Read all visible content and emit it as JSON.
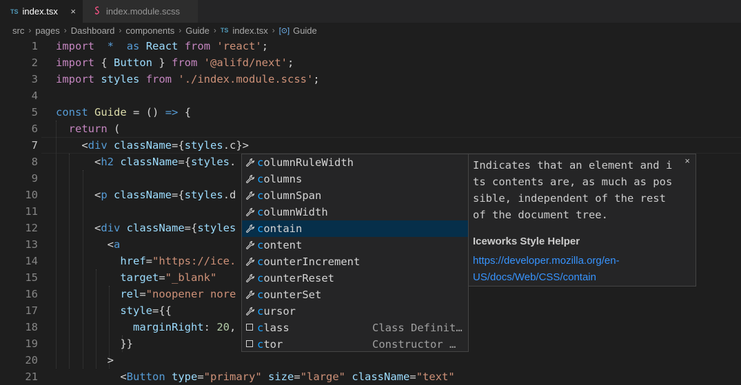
{
  "tabs": [
    {
      "badge": "TS",
      "label": "index.tsx",
      "close": "×",
      "active": true
    },
    {
      "badge": "",
      "label": "index.module.scss",
      "active": false
    }
  ],
  "breadcrumb": {
    "items": [
      "src",
      "pages",
      "Dashboard",
      "components",
      "Guide"
    ],
    "file_badge": "TS",
    "file": "index.tsx",
    "symbol_icon": "[⊙]",
    "symbol": "Guide",
    "separator": "›"
  },
  "editor": {
    "line_numbers": [
      "1",
      "2",
      "3",
      "4",
      "5",
      "6",
      "7",
      "8",
      "9",
      "10",
      "11",
      "12",
      "13",
      "14",
      "15",
      "16",
      "17",
      "18",
      "19",
      "20",
      "21"
    ],
    "current_line": "7",
    "lines": [
      [
        [
          "kc",
          "import"
        ],
        [
          "",
          "  "
        ],
        [
          "kw",
          "*"
        ],
        [
          "",
          "  "
        ],
        [
          "kw",
          "as"
        ],
        [
          "",
          " "
        ],
        [
          "var",
          "React"
        ],
        [
          "",
          " "
        ],
        [
          "kc",
          "from"
        ],
        [
          "",
          " "
        ],
        [
          "str",
          "'react'"
        ],
        [
          "",
          ";"
        ]
      ],
      [
        [
          "kc",
          "import"
        ],
        [
          "",
          " { "
        ],
        [
          "var",
          "Button"
        ],
        [
          "",
          " } "
        ],
        [
          "kc",
          "from"
        ],
        [
          "",
          " "
        ],
        [
          "str",
          "'@alifd/next'"
        ],
        [
          "",
          ";"
        ]
      ],
      [
        [
          "kc",
          "import"
        ],
        [
          "",
          " "
        ],
        [
          "var",
          "styles"
        ],
        [
          "",
          " "
        ],
        [
          "kc",
          "from"
        ],
        [
          "",
          " "
        ],
        [
          "str",
          "'./index.module.scss'"
        ],
        [
          "",
          ";"
        ]
      ],
      [],
      [
        [
          "kw",
          "const"
        ],
        [
          "",
          " "
        ],
        [
          "fn",
          "Guide"
        ],
        [
          "",
          " = () "
        ],
        [
          "kw",
          "=>"
        ],
        [
          "",
          " {"
        ]
      ],
      [
        [
          "",
          ""
        ],
        [
          "kc",
          "  return"
        ],
        [
          "",
          " ("
        ]
      ],
      [
        [
          "",
          "    <"
        ],
        [
          "tag",
          "div"
        ],
        [
          "",
          " "
        ],
        [
          "attr",
          "className"
        ],
        [
          "",
          "={"
        ],
        [
          "var",
          "styles"
        ],
        [
          "",
          ".c}>"
        ]
      ],
      [
        [
          "",
          "      <"
        ],
        [
          "tag",
          "h2"
        ],
        [
          "",
          " "
        ],
        [
          "attr",
          "className"
        ],
        [
          "",
          "={"
        ],
        [
          "var",
          "styles"
        ],
        [
          "",
          "."
        ]
      ],
      [],
      [
        [
          "",
          "      <"
        ],
        [
          "tag",
          "p"
        ],
        [
          "",
          " "
        ],
        [
          "attr",
          "className"
        ],
        [
          "",
          "={"
        ],
        [
          "var",
          "styles"
        ],
        [
          "",
          ".d"
        ]
      ],
      [],
      [
        [
          "",
          "      <"
        ],
        [
          "tag",
          "div"
        ],
        [
          "",
          " "
        ],
        [
          "attr",
          "className"
        ],
        [
          "",
          "={"
        ],
        [
          "var",
          "styles"
        ]
      ],
      [
        [
          "",
          "        <"
        ],
        [
          "tag",
          "a"
        ]
      ],
      [
        [
          "attr",
          "          href"
        ],
        [
          "",
          "="
        ],
        [
          "str",
          "\"https://ice."
        ]
      ],
      [
        [
          "attr",
          "          target"
        ],
        [
          "",
          "="
        ],
        [
          "str",
          "\"_blank\""
        ]
      ],
      [
        [
          "attr",
          "          rel"
        ],
        [
          "",
          "="
        ],
        [
          "str",
          "\"noopener nore"
        ]
      ],
      [
        [
          "attr",
          "          style"
        ],
        [
          "",
          "={{"
        ]
      ],
      [
        [
          "var",
          "            marginRight"
        ],
        [
          "",
          ": "
        ],
        [
          "num",
          "20"
        ],
        [
          "",
          ","
        ]
      ],
      [
        [
          "",
          "          }}"
        ]
      ],
      [
        [
          "",
          "        >"
        ]
      ],
      [
        [
          "",
          "          <"
        ],
        [
          "tag",
          "Button"
        ],
        [
          "",
          " "
        ],
        [
          "attr",
          "type"
        ],
        [
          "",
          "="
        ],
        [
          "str",
          "\"primary\""
        ],
        [
          "",
          " "
        ],
        [
          "attr",
          "size"
        ],
        [
          "",
          "="
        ],
        [
          "str",
          "\"large\""
        ],
        [
          "",
          " "
        ],
        [
          "attr",
          "className"
        ],
        [
          "",
          "="
        ],
        [
          "str",
          "\"text\""
        ]
      ]
    ]
  },
  "suggest": {
    "items": [
      {
        "icon": "wrench-icon",
        "match": "c",
        "rest": "olumnRuleWidth",
        "detail": ""
      },
      {
        "icon": "wrench-icon",
        "match": "c",
        "rest": "olumns",
        "detail": ""
      },
      {
        "icon": "wrench-icon",
        "match": "c",
        "rest": "olumnSpan",
        "detail": ""
      },
      {
        "icon": "wrench-icon",
        "match": "c",
        "rest": "olumnWidth",
        "detail": ""
      },
      {
        "icon": "wrench-icon",
        "match": "c",
        "rest": "ontain",
        "detail": "",
        "selected": true
      },
      {
        "icon": "wrench-icon",
        "match": "c",
        "rest": "ontent",
        "detail": ""
      },
      {
        "icon": "wrench-icon",
        "match": "c",
        "rest": "ounterIncrement",
        "detail": ""
      },
      {
        "icon": "wrench-icon",
        "match": "c",
        "rest": "ounterReset",
        "detail": ""
      },
      {
        "icon": "wrench-icon",
        "match": "c",
        "rest": "ounterSet",
        "detail": ""
      },
      {
        "icon": "wrench-icon",
        "match": "c",
        "rest": "ursor",
        "detail": ""
      },
      {
        "icon": "snippet-icon",
        "match": "c",
        "rest": "lass",
        "detail": "Class Definit…"
      },
      {
        "icon": "snippet-icon",
        "match": "c",
        "rest": "tor",
        "detail": "Constructor …"
      }
    ]
  },
  "details": {
    "doc_lines": [
      "Indicates that an element and i",
      "ts contents are, as much as pos",
      "sible, independent of the rest",
      "of the document tree."
    ],
    "title": "Iceworks Style Helper",
    "link": "https://developer.mozilla.org/en-US/docs/Web/CSS/contain",
    "close": "×"
  },
  "colors": {
    "accent": "#3794ff",
    "selection": "#062f4a",
    "match_highlight": "#18a3ff"
  }
}
